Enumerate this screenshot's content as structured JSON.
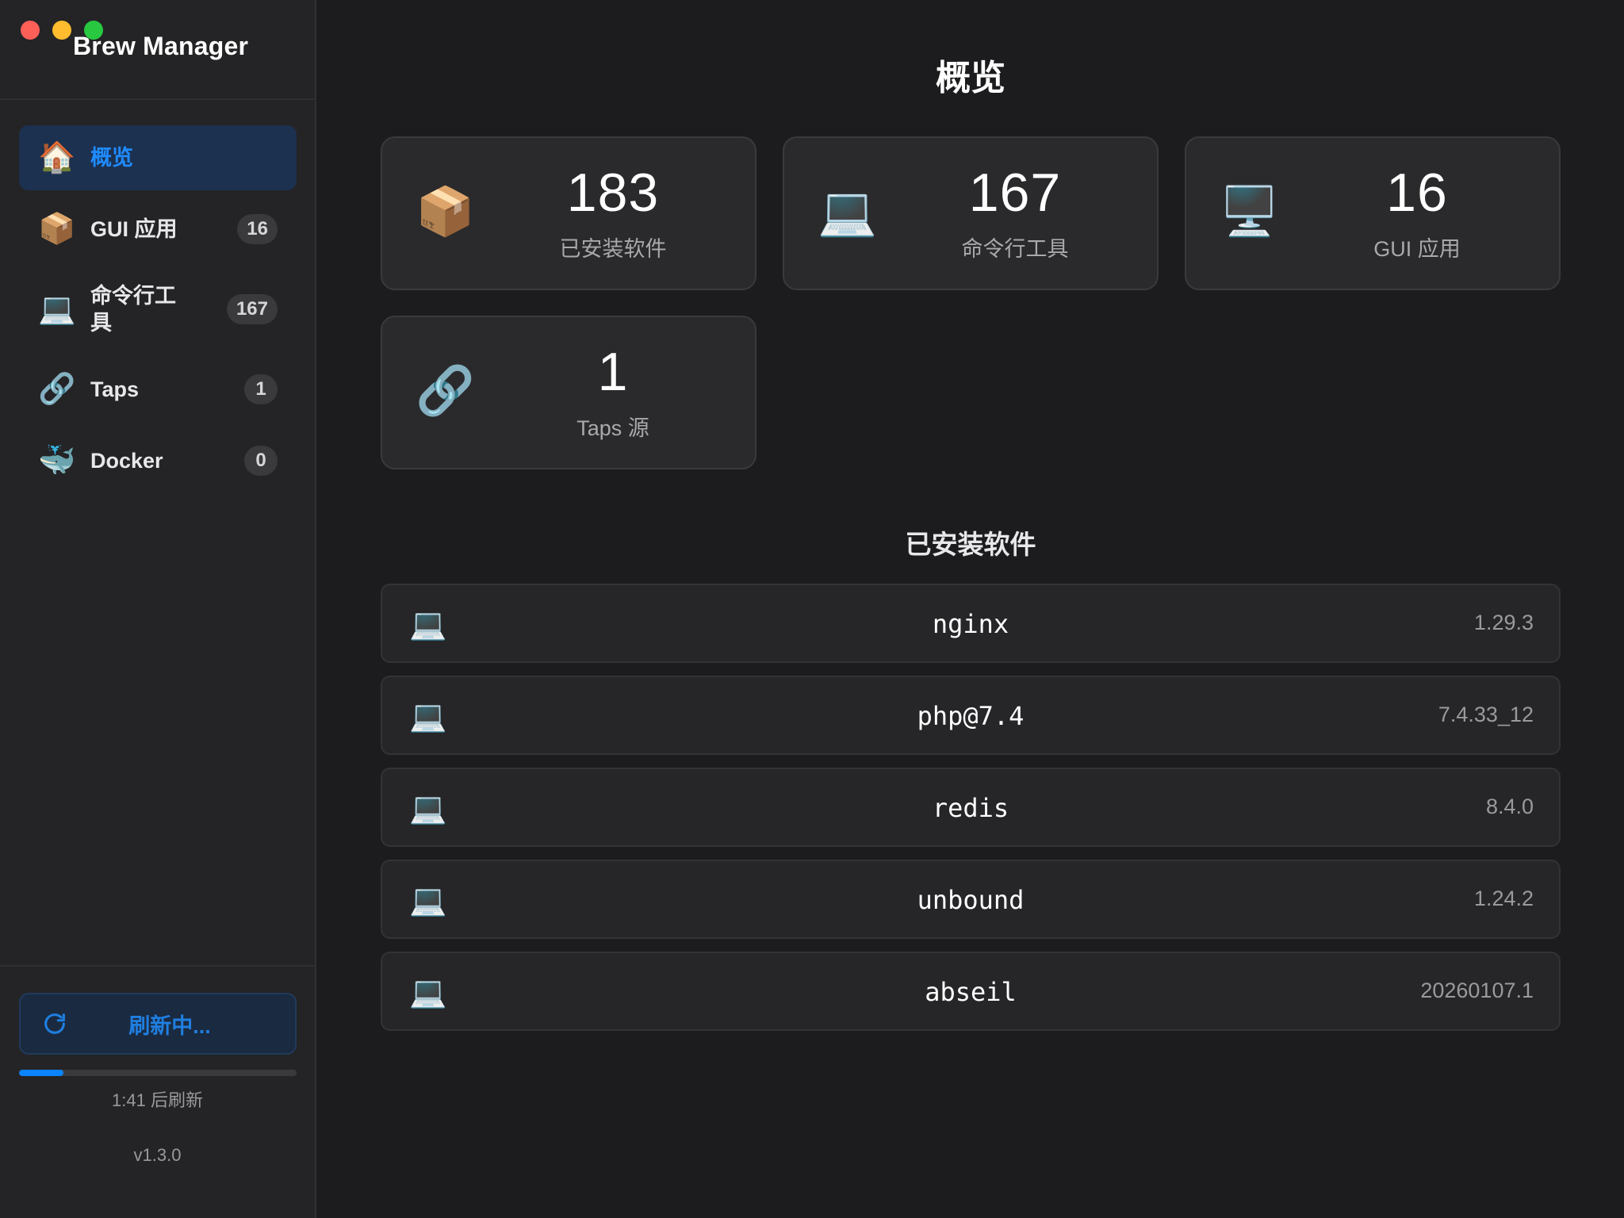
{
  "app": {
    "title": "Brew Manager"
  },
  "sidebar": {
    "items": [
      {
        "label": "概览",
        "icon": "house-icon",
        "active": true
      },
      {
        "label": "GUI 应用",
        "icon": "package-icon",
        "count": "16"
      },
      {
        "label": "命令行工具",
        "icon": "laptop-icon",
        "count": "167"
      },
      {
        "label": "Taps",
        "icon": "link-icon",
        "count": "1"
      },
      {
        "label": "Docker",
        "icon": "whale-icon",
        "count": "0"
      }
    ],
    "refresh_label": "刷新中...",
    "refresh_progress": 0.16,
    "countdown": "1:41 后刷新",
    "version": "v1.3.0"
  },
  "main": {
    "title": "概览",
    "stats": [
      {
        "value": "183",
        "label": "已安装软件",
        "icon": "package-icon"
      },
      {
        "value": "167",
        "label": "命令行工具",
        "icon": "laptop-icon"
      },
      {
        "value": "16",
        "label": "GUI 应用",
        "icon": "desktop-computer-icon"
      },
      {
        "value": "1",
        "label": "Taps 源",
        "icon": "link-icon"
      }
    ],
    "section_title": "已安装软件",
    "packages": [
      {
        "name": "nginx",
        "version": "1.29.3",
        "icon": "laptop-icon"
      },
      {
        "name": "php@7.4",
        "version": "7.4.33_12",
        "icon": "laptop-icon"
      },
      {
        "name": "redis",
        "version": "8.4.0",
        "icon": "laptop-icon"
      },
      {
        "name": "unbound",
        "version": "1.24.2",
        "icon": "laptop-icon"
      },
      {
        "name": "abseil",
        "version": "20260107.1",
        "icon": "laptop-icon"
      }
    ]
  },
  "colors": {
    "accent": "#0a84ff",
    "background": "#1c1c1e",
    "sidebar": "#242426",
    "card": "#2a2a2c"
  }
}
